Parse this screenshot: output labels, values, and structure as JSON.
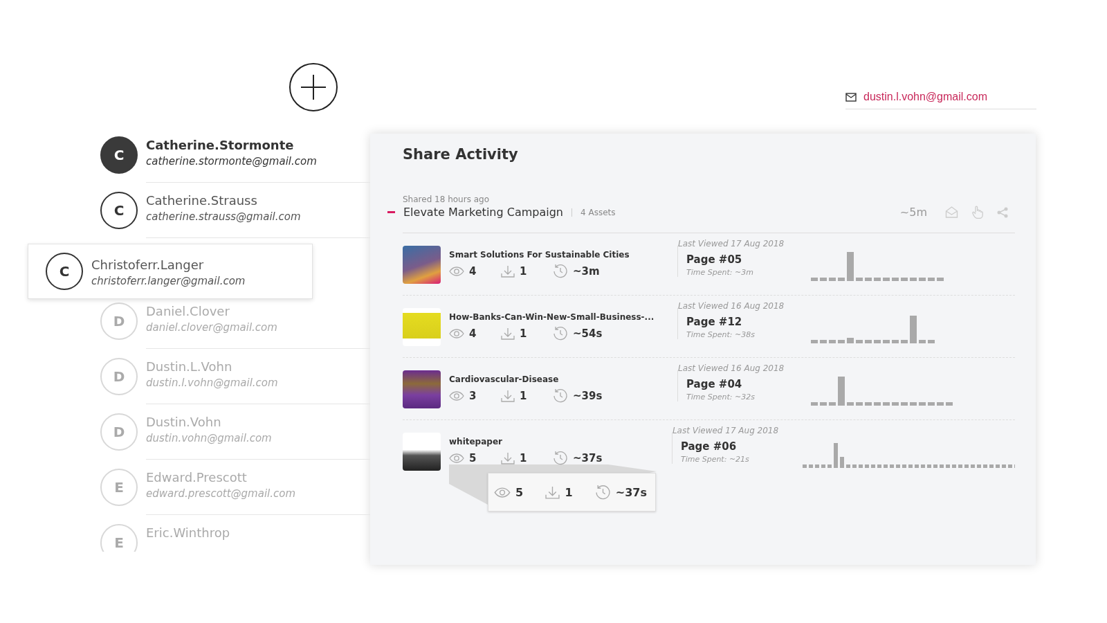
{
  "account_email": "dustin.l.vohn@gmail.com",
  "contacts": [
    {
      "initial": "C",
      "name": "Catherine.Stormonte",
      "email": "catherine.stormonte@gmail.com",
      "selected": true,
      "kind": "normal"
    },
    {
      "initial": "C",
      "name": "Catherine.Strauss",
      "email": "catherine.strauss@gmail.com",
      "selected": false,
      "kind": "normal"
    },
    {
      "initial": "C",
      "name": "Christoferr.Langer",
      "email": "christoferr.langer@gmail.com",
      "selected": false,
      "kind": "dragged"
    },
    {
      "initial": "D",
      "name": "Daniel.Clover",
      "email": "daniel.clover@gmail.com",
      "selected": false,
      "kind": "faded"
    },
    {
      "initial": "D",
      "name": "Dustin.L.Vohn",
      "email": "dustin.l.vohn@gmail.com",
      "selected": false,
      "kind": "faded"
    },
    {
      "initial": "D",
      "name": "Dustin.Vohn",
      "email": "dustin.vohn@gmail.com",
      "selected": false,
      "kind": "faded"
    },
    {
      "initial": "E",
      "name": "Edward.Prescott",
      "email": "edward.prescott@gmail.com",
      "selected": false,
      "kind": "faded"
    },
    {
      "initial": "E",
      "name": "Eric.Winthrop",
      "selected": false,
      "kind": "faded"
    }
  ],
  "panel": {
    "title": "Share Activity",
    "share": {
      "shared_time": "Shared 18 hours ago",
      "title": "Elevate Marketing Campaign",
      "expanded": true,
      "assets_count": "4 Assets",
      "total_time": "~5m"
    },
    "assets": [
      {
        "title": "Smart Solutions For Sustainable Cities",
        "views": "4",
        "downloads": "1",
        "time": "~3m",
        "last_viewed": "Last Viewed 17 Aug 2018",
        "page": "Page #05",
        "time_spent": "Time Spent: ~3m"
      },
      {
        "title": "How-Banks-Can-Win-New-Small-Business-...",
        "views": "4",
        "downloads": "1",
        "time": "~54s",
        "last_viewed": "Last Viewed 16 Aug 2018",
        "page": "Page #12",
        "time_spent": "Time Spent: ~38s"
      },
      {
        "title": "Cardiovascular-Disease",
        "views": "3",
        "downloads": "1",
        "time": "~39s",
        "last_viewed": "Last Viewed 16 Aug 2018",
        "page": "Page #04",
        "time_spent": "Time Spent: ~32s"
      },
      {
        "title": "whitepaper",
        "views": "5",
        "downloads": "1",
        "time": "~37s",
        "last_viewed": "Last Viewed 17 Aug 2018",
        "page": "Page #06",
        "time_spent": "Time Spent: ~21s",
        "callout": {
          "views": "5",
          "downloads": "1",
          "time": "~37s"
        }
      }
    ]
  }
}
